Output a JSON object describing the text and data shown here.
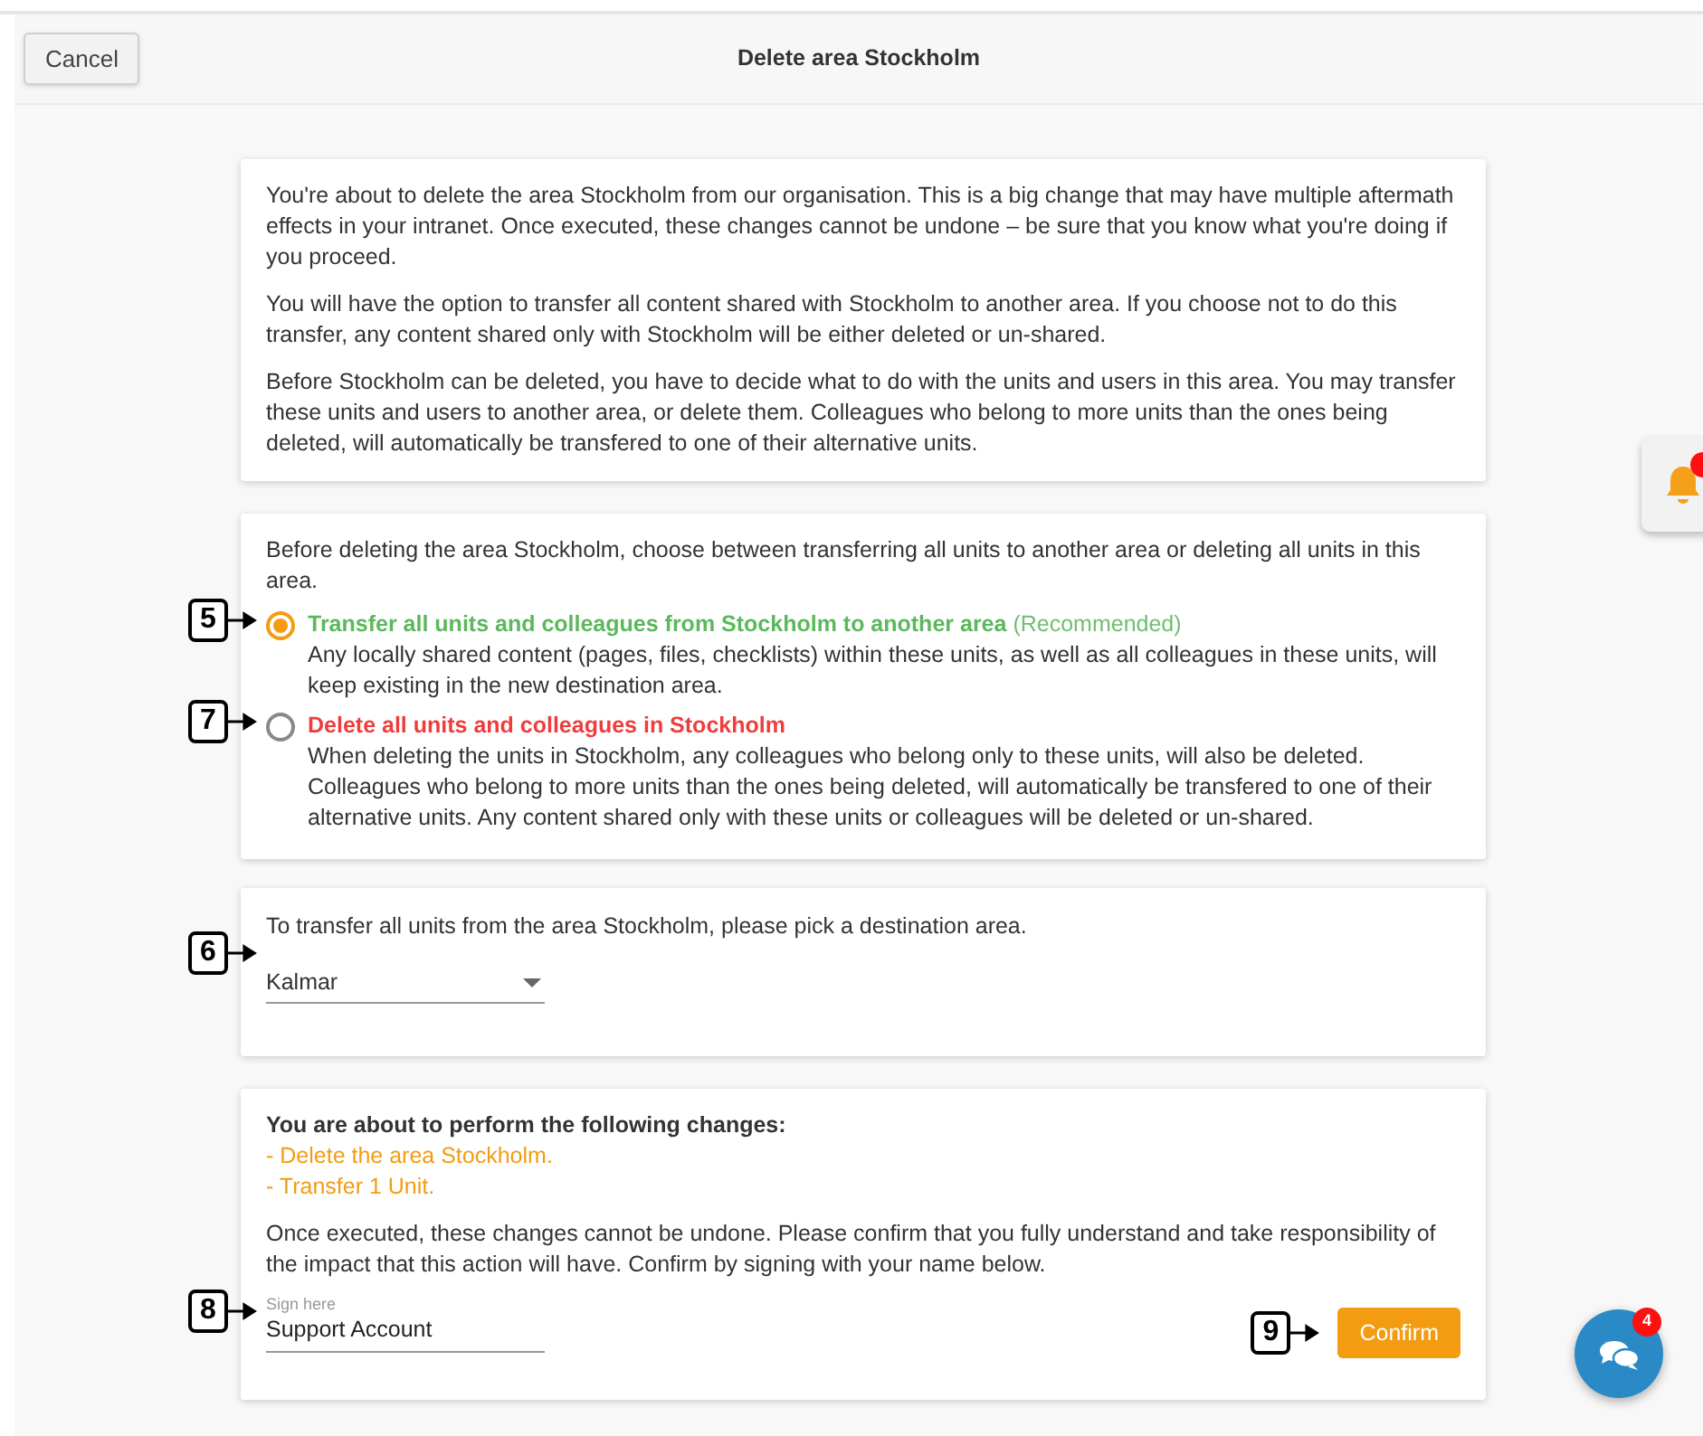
{
  "header": {
    "cancel": "Cancel",
    "title": "Delete area Stockholm"
  },
  "intro": [
    "You're about to delete the area Stockholm from our organisation. This is a big change that may have multiple aftermath effects in your intranet. Once executed, these changes cannot be undone – be sure that you know what you're doing if you proceed.",
    "You will have the option to transfer all content shared with Stockholm to another area. If you choose not to do this transfer, any content shared only with Stockholm will be either deleted or un-shared.",
    "Before Stockholm can be deleted, you have to decide what to do with the units and users in this area. You may transfer these units and users to another area, or delete them. Colleagues who belong to more units than the ones being deleted, will automatically be transfered to one of their alternative units."
  ],
  "choice": {
    "prompt": "Before deleting the area Stockholm, choose between transferring all units to another area or deleting all units in this area.",
    "options": [
      {
        "kind": "transfer",
        "callout": "5",
        "selected": true,
        "label": "Transfer all units and colleagues from Stockholm to another area",
        "note": "(Recommended)",
        "description": "Any locally shared content (pages, files, checklists) within these units, as well as all colleagues in these units, will keep existing in the new destination area."
      },
      {
        "kind": "delete",
        "callout": "7",
        "selected": false,
        "label": "Delete all units and colleagues in Stockholm",
        "description": "When deleting the units in Stockholm, any colleagues who belong only to these units, will also be deleted. Colleagues who belong to more units than the ones being deleted, will automatically be transfered to one of their alternative units. Any content shared only with these units or colleagues will be deleted or un-shared."
      }
    ]
  },
  "destination": {
    "prompt": "To transfer all units from the area Stockholm, please pick a destination area.",
    "callout": "6",
    "value": "Kalmar"
  },
  "summary": {
    "heading": "You are about to perform the following changes:",
    "changes": [
      "- Delete the area Stockholm.",
      "- Transfer 1 Unit."
    ],
    "text": "Once executed, these changes cannot be undone. Please confirm that you fully understand and take responsibility of the impact that this action will have. Confirm by signing with your name below.",
    "sign": {
      "label": "Sign here",
      "value": "Support Account",
      "callout": "8"
    },
    "confirm": {
      "label": "Confirm",
      "callout": "9"
    }
  },
  "chat": {
    "badge": "4"
  }
}
